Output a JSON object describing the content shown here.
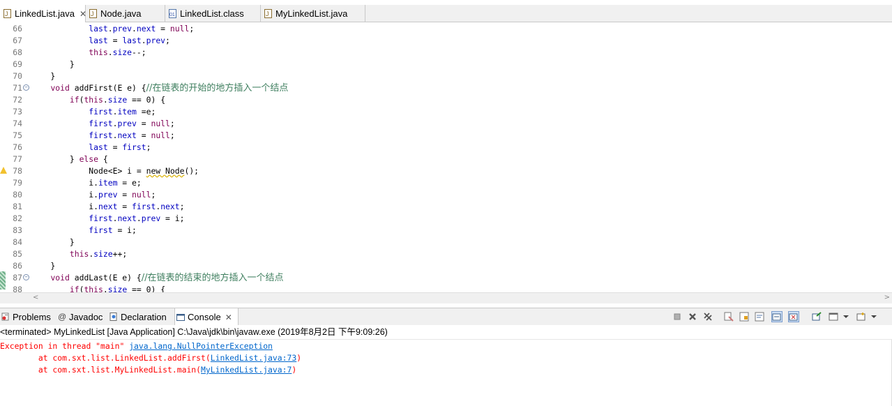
{
  "editor_tabs": [
    {
      "label": "LinkedList.java",
      "active": true,
      "closable": true,
      "icon": "java-file-icon"
    },
    {
      "label": "Node.java",
      "active": false,
      "icon": "java-file-icon"
    },
    {
      "label": "LinkedList.class",
      "active": false,
      "icon": "class-file-icon"
    },
    {
      "label": "MyLinkedList.java",
      "active": false,
      "icon": "java-file-icon"
    }
  ],
  "close_glyph": "✕",
  "code_lines": [
    {
      "n": "66",
      "segs": [
        [
          "p",
          "            "
        ],
        [
          "f",
          "last"
        ],
        [
          "p",
          "."
        ],
        [
          "f",
          "prev"
        ],
        [
          "p",
          "."
        ],
        [
          "f",
          "next"
        ],
        [
          "p",
          " = "
        ],
        [
          "k",
          "null"
        ],
        [
          "p",
          ";"
        ]
      ]
    },
    {
      "n": "67",
      "segs": [
        [
          "p",
          "            "
        ],
        [
          "f",
          "last"
        ],
        [
          "p",
          " = "
        ],
        [
          "f",
          "last"
        ],
        [
          "p",
          "."
        ],
        [
          "f",
          "prev"
        ],
        [
          "p",
          ";"
        ]
      ]
    },
    {
      "n": "68",
      "segs": [
        [
          "p",
          "            "
        ],
        [
          "k",
          "this"
        ],
        [
          "p",
          "."
        ],
        [
          "f",
          "size"
        ],
        [
          "p",
          "--;"
        ]
      ]
    },
    {
      "n": "69",
      "segs": [
        [
          "p",
          "        }"
        ]
      ]
    },
    {
      "n": "70",
      "segs": [
        [
          "p",
          "    }"
        ]
      ]
    },
    {
      "n": "71",
      "fold": true,
      "segs": [
        [
          "p",
          "    "
        ],
        [
          "k",
          "void"
        ],
        [
          "p",
          " addFirst(E e) {"
        ],
        [
          "c",
          "//在链表的开始的地方插入一个结点"
        ]
      ]
    },
    {
      "n": "72",
      "segs": [
        [
          "p",
          "        "
        ],
        [
          "k",
          "if"
        ],
        [
          "p",
          "("
        ],
        [
          "k",
          "this"
        ],
        [
          "p",
          "."
        ],
        [
          "f",
          "size"
        ],
        [
          "p",
          " == 0) {"
        ]
      ]
    },
    {
      "n": "73",
      "segs": [
        [
          "p",
          "            "
        ],
        [
          "f",
          "first"
        ],
        [
          "p",
          "."
        ],
        [
          "f",
          "item"
        ],
        [
          "p",
          " =e;"
        ]
      ]
    },
    {
      "n": "74",
      "segs": [
        [
          "p",
          "            "
        ],
        [
          "f",
          "first"
        ],
        [
          "p",
          "."
        ],
        [
          "f",
          "prev"
        ],
        [
          "p",
          " = "
        ],
        [
          "k",
          "null"
        ],
        [
          "p",
          ";"
        ]
      ]
    },
    {
      "n": "75",
      "segs": [
        [
          "p",
          "            "
        ],
        [
          "f",
          "first"
        ],
        [
          "p",
          "."
        ],
        [
          "f",
          "next"
        ],
        [
          "p",
          " = "
        ],
        [
          "k",
          "null"
        ],
        [
          "p",
          ";"
        ]
      ]
    },
    {
      "n": "76",
      "segs": [
        [
          "p",
          "            "
        ],
        [
          "f",
          "last"
        ],
        [
          "p",
          " = "
        ],
        [
          "f",
          "first"
        ],
        [
          "p",
          ";"
        ]
      ]
    },
    {
      "n": "77",
      "segs": [
        [
          "p",
          "        } "
        ],
        [
          "k",
          "else"
        ],
        [
          "p",
          " {"
        ]
      ]
    },
    {
      "n": "78",
      "warn": true,
      "segs": [
        [
          "p",
          "            Node<E> i = "
        ],
        [
          "w",
          "new Node"
        ],
        [
          "p",
          "();"
        ]
      ]
    },
    {
      "n": "79",
      "segs": [
        [
          "p",
          "            i."
        ],
        [
          "f",
          "item"
        ],
        [
          "p",
          " = e;"
        ]
      ]
    },
    {
      "n": "80",
      "segs": [
        [
          "p",
          "            i."
        ],
        [
          "f",
          "prev"
        ],
        [
          "p",
          " = "
        ],
        [
          "k",
          "null"
        ],
        [
          "p",
          ";"
        ]
      ]
    },
    {
      "n": "81",
      "segs": [
        [
          "p",
          "            i."
        ],
        [
          "f",
          "next"
        ],
        [
          "p",
          " = "
        ],
        [
          "f",
          "first"
        ],
        [
          "p",
          "."
        ],
        [
          "f",
          "next"
        ],
        [
          "p",
          ";"
        ]
      ]
    },
    {
      "n": "82",
      "segs": [
        [
          "p",
          "            "
        ],
        [
          "f",
          "first"
        ],
        [
          "p",
          "."
        ],
        [
          "f",
          "next"
        ],
        [
          "p",
          "."
        ],
        [
          "f",
          "prev"
        ],
        [
          "p",
          " = i;"
        ]
      ]
    },
    {
      "n": "83",
      "segs": [
        [
          "p",
          "            "
        ],
        [
          "f",
          "first"
        ],
        [
          "p",
          " = i;"
        ]
      ]
    },
    {
      "n": "84",
      "segs": [
        [
          "p",
          "        }"
        ]
      ]
    },
    {
      "n": "85",
      "segs": [
        [
          "p",
          "        "
        ],
        [
          "k",
          "this"
        ],
        [
          "p",
          "."
        ],
        [
          "f",
          "size"
        ],
        [
          "p",
          "++;"
        ]
      ]
    },
    {
      "n": "86",
      "segs": [
        [
          "p",
          "    }"
        ]
      ]
    },
    {
      "n": "87",
      "fold": true,
      "segs": [
        [
          "p",
          "    "
        ],
        [
          "k",
          "void"
        ],
        [
          "p",
          " addLast(E e) {"
        ],
        [
          "c",
          "//在链表的结束的地方插入一个结点"
        ]
      ]
    },
    {
      "n": "88",
      "segs": [
        [
          "p",
          "        "
        ],
        [
          "k",
          "if"
        ],
        [
          "p",
          "("
        ],
        [
          "k",
          "this"
        ],
        [
          "p",
          "."
        ],
        [
          "f",
          "size"
        ],
        [
          "p",
          " == 0) {"
        ]
      ]
    }
  ],
  "view_tabs": [
    {
      "label": "Problems",
      "icon": "problems-icon",
      "active": false
    },
    {
      "label": "Javadoc",
      "icon": "javadoc-icon",
      "active": false
    },
    {
      "label": "Declaration",
      "icon": "declaration-icon",
      "active": false
    },
    {
      "label": "Console",
      "icon": "console-icon",
      "active": true,
      "closable": true
    }
  ],
  "console": {
    "terminated_line": "<terminated> MyLinkedList [Java Application] C:\\Java\\jdk\\bin\\javaw.exe (2019年8月2日 下午9:09:26)",
    "lines": [
      {
        "pre": "Exception in thread \"main\" ",
        "link": "java.lang.NullPointerException",
        "post": ""
      },
      {
        "pre": "\tat com.sxt.list.LinkedList.addFirst(",
        "link": "LinkedList.java:73",
        "post": ")"
      },
      {
        "pre": "\tat com.sxt.list.MyLinkedList.main(",
        "link": "MyLinkedList.java:7",
        "post": ")"
      }
    ]
  },
  "toolbar_icons": [
    "terminate-icon",
    "remove-launch-icon",
    "remove-all-terminated-icon",
    "clear-console-icon",
    "scroll-lock-icon",
    "word-wrap-icon",
    "show-on-stdout-icon",
    "show-on-stderr-icon",
    "pin-console-icon",
    "display-console-icon",
    "dropdown-icon",
    "new-console-icon",
    "view-menu-icon"
  ],
  "colors": {
    "keyword": "#7f0055",
    "field": "#0000c0",
    "comment": "#3f7f5f",
    "error": "#ff0000",
    "link": "#0066cc"
  }
}
